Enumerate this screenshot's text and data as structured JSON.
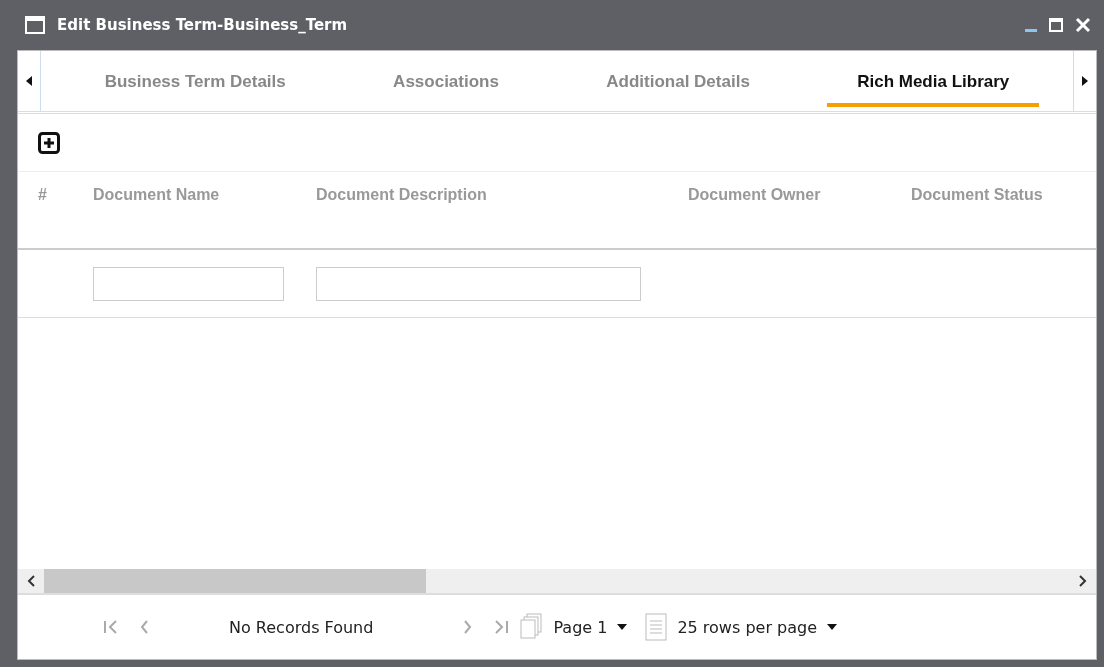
{
  "window": {
    "title": "Edit Business Term-Business_Term"
  },
  "tabs": [
    {
      "label": "Business Term Details",
      "selected": false
    },
    {
      "label": "Associations",
      "selected": false
    },
    {
      "label": "Additional Details",
      "selected": false
    },
    {
      "label": "Rich Media Library",
      "selected": true
    }
  ],
  "table": {
    "columns": [
      "#",
      "Document Name",
      "Document Description",
      "Document Owner",
      "Document Status"
    ],
    "filter_fields": [
      {
        "kind": "text"
      },
      {
        "kind": "text"
      }
    ]
  },
  "pager": {
    "status": "No Records Found",
    "page": "Page 1",
    "rows_per_page": "25 rows per page"
  }
}
